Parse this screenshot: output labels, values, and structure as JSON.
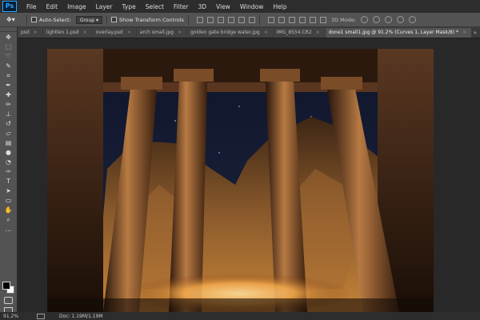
{
  "app": {
    "logo": "Ps"
  },
  "menu": [
    "File",
    "Edit",
    "Image",
    "Layer",
    "Type",
    "Select",
    "Filter",
    "3D",
    "View",
    "Window",
    "Help"
  ],
  "options_bar": {
    "auto_select_label": "Auto-Select:",
    "auto_select_value": "Group",
    "show_transform_label": "Show Transform Controls",
    "mode_3d_label": "3D Mode:"
  },
  "tabs": [
    {
      "label": "psd"
    },
    {
      "label": "lightlen 1.psd"
    },
    {
      "label": "overlay.psd"
    },
    {
      "label": "arch small.jpg"
    },
    {
      "label": "golden gate bridge water.jpg"
    },
    {
      "label": "IMG_8554.CR2"
    },
    {
      "label": "done1 small1.jpg @ 91.2% (Curves 1, Layer Mask/8) *",
      "active": true
    }
  ],
  "tabs_more": "»",
  "statusbar": {
    "zoom": "91.2%",
    "doc": "Doc: 1.19M/1.19M"
  },
  "colors": {
    "foreground": "#000000",
    "background": "#ffffff",
    "accent": "#31a8ff"
  },
  "icons": {
    "tools": [
      "move-icon",
      "marquee-icon",
      "lasso-icon",
      "quick-select-icon",
      "crop-icon",
      "eyedropper-icon",
      "healing-brush-icon",
      "brush-icon",
      "clone-stamp-icon",
      "history-brush-icon",
      "eraser-icon",
      "gradient-icon",
      "blur-icon",
      "dodge-icon",
      "pen-icon",
      "type-icon",
      "path-select-icon",
      "rectangle-icon",
      "hand-icon",
      "zoom-icon"
    ]
  }
}
